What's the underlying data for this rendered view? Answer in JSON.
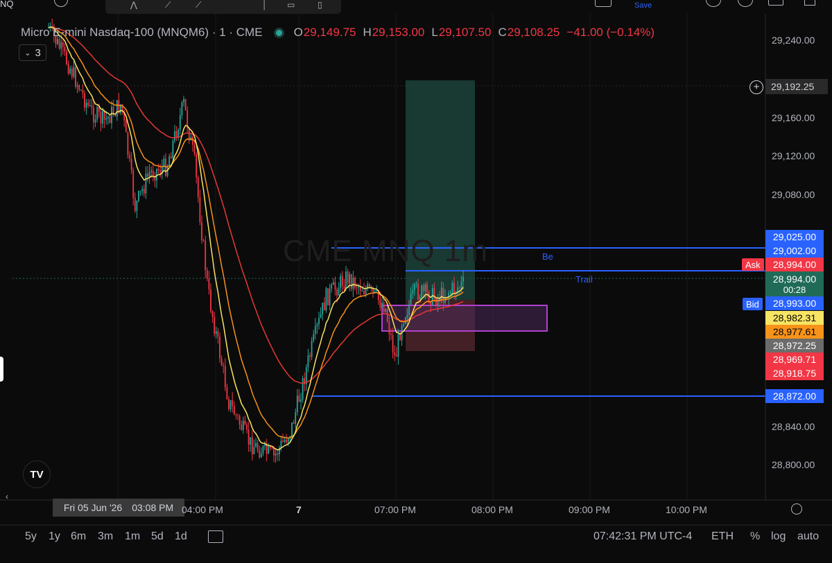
{
  "header": {
    "symbol_title": "Micro E-mini Nasdaq-100 (MNQM6) · 1 · CME",
    "open_label": "O",
    "open": "29,149.75",
    "high_label": "H",
    "high": "29,153.00",
    "low_label": "L",
    "low": "29,107.50",
    "close_label": "C",
    "close": "29,108.25",
    "change": "−41.00 (−0.14%)",
    "indicator_count": "3",
    "ticker_fragment": "NQ",
    "save_label": "Save"
  },
  "watermark": "CME MNQ 1m",
  "levels": {
    "be_label": "Be",
    "trail_label": "Trail",
    "ask_label": "Ask",
    "bid_label": "Bid"
  },
  "price_axis": {
    "ticks": [
      "29,240.00",
      "29,160.00",
      "29,120.00",
      "29,080.00",
      "28,840.00",
      "28,800.00"
    ],
    "crosshair_price": "29,192.25",
    "tags": [
      {
        "label": "29,025.00",
        "color": "#2962ff"
      },
      {
        "label": "29,002.00",
        "color": "#2962ff"
      },
      {
        "label": "28,994.00",
        "color": "#f23645"
      },
      {
        "label": "28,994.00",
        "color": "#1f6b58"
      },
      {
        "label": "00:28",
        "color": "#1f6b58"
      },
      {
        "label": "28,993.00",
        "color": "#2962ff"
      },
      {
        "label": "28,982.31",
        "color": "#f7e463"
      },
      {
        "label": "28,977.61",
        "color": "#f7931a"
      },
      {
        "label": "28,972.25",
        "color": "#6b6b6b"
      },
      {
        "label": "28,969.71",
        "color": "#f23645"
      },
      {
        "label": "28,918.75",
        "color": "#f23645"
      },
      {
        "label": "28,872.00",
        "color": "#2962ff"
      }
    ]
  },
  "time_axis": {
    "cursor_date": "Fri 05 Jun '26",
    "cursor_time": "03:08 PM",
    "ticks": [
      "04:00 PM",
      "7",
      "07:00 PM",
      "08:00 PM",
      "09:00 PM",
      "10:00 PM"
    ]
  },
  "bottom_bar": {
    "ranges": [
      "5y",
      "1y",
      "6m",
      "3m",
      "1m",
      "5d",
      "1d"
    ],
    "clock": "07:42:31 PM UTC-4",
    "session": "ETH",
    "percent": "%",
    "log": "log",
    "auto": "auto"
  },
  "brand": "TV",
  "colors": {
    "background": "#0b0b0b",
    "bull": "#26a69a",
    "bear": "#f23645",
    "level_line": "#2962ff",
    "ema_fast": "#f7e463",
    "ema_mid": "#f7931a",
    "ema_slow": "#e53935",
    "zone": "#9c27b0"
  }
}
